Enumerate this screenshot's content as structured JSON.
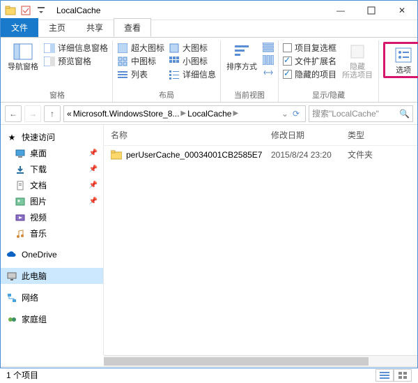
{
  "window": {
    "title": "LocalCache"
  },
  "tabs": {
    "file": "文件",
    "home": "主页",
    "share": "共享",
    "view": "查看"
  },
  "ribbon": {
    "panes": {
      "nav": "导航窗格",
      "detail_pane": "详细信息窗格",
      "preview": "预览窗格",
      "label": "窗格"
    },
    "layout": {
      "xl": "超大图标",
      "l": "大图标",
      "m": "中图标",
      "s": "小图标",
      "list": "列表",
      "details": "详细信息",
      "label": "布局"
    },
    "currentview": {
      "sort": "排序方式",
      "label": "当前视图"
    },
    "showhide": {
      "checkboxes": "项目复选框",
      "ext": "文件扩展名",
      "hidden": "隐藏的项目",
      "hide_selected": "隐藏\n所选项目",
      "label": "显示/隐藏"
    },
    "options": {
      "label": "选项"
    }
  },
  "breadcrumbs": {
    "seg1": "Microsoft.WindowsStore_8...",
    "seg2": "LocalCache"
  },
  "nav": {
    "search_placeholder": "搜索\"LocalCache\""
  },
  "sidebar": {
    "quick": "快速访问",
    "items": [
      "桌面",
      "下载",
      "文档",
      "图片",
      "视频",
      "音乐"
    ],
    "onedrive": "OneDrive",
    "thispc": "此电脑",
    "network": "网络",
    "homegroup": "家庭组"
  },
  "columns": {
    "name": "名称",
    "date": "修改日期",
    "type": "类型"
  },
  "rows": [
    {
      "name": "perUserCache_00034001CB2585E7",
      "date": "2015/8/24 23:20",
      "type": "文件夹"
    }
  ],
  "status": {
    "count": "1 个项目"
  }
}
